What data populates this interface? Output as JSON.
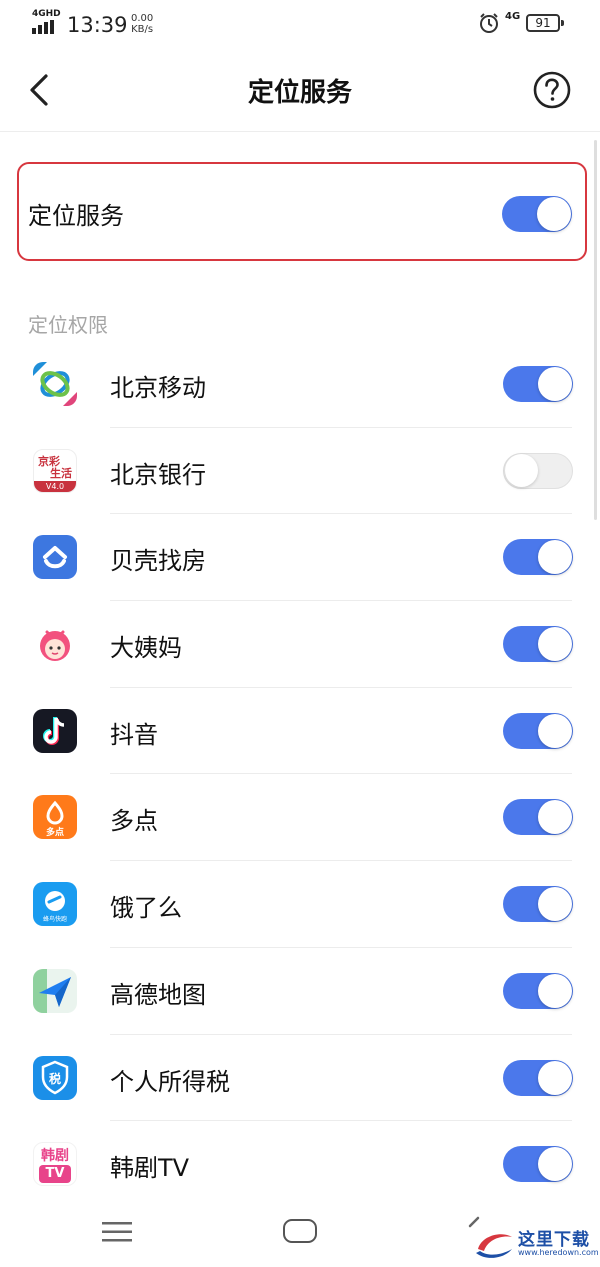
{
  "status_bar": {
    "network": "4GHD",
    "time": "13:39",
    "speed_value": "0.00",
    "speed_unit": "KB/s",
    "network_right": "4G",
    "battery": "91"
  },
  "header": {
    "title": "定位服务"
  },
  "master": {
    "label": "定位服务",
    "enabled": true
  },
  "section_title": "定位权限",
  "apps": [
    {
      "name": "北京移动",
      "enabled": true,
      "icon": "china-mobile-icon"
    },
    {
      "name": "北京银行",
      "enabled": false,
      "icon": "bank-of-beijing-icon"
    },
    {
      "name": "贝壳找房",
      "enabled": true,
      "icon": "beike-icon"
    },
    {
      "name": "大姨妈",
      "enabled": true,
      "icon": "dayima-icon"
    },
    {
      "name": "抖音",
      "enabled": true,
      "icon": "douyin-icon"
    },
    {
      "name": "多点",
      "enabled": true,
      "icon": "duodian-icon"
    },
    {
      "name": "饿了么",
      "enabled": true,
      "icon": "eleme-icon"
    },
    {
      "name": "高德地图",
      "enabled": true,
      "icon": "amap-icon"
    },
    {
      "name": "个人所得税",
      "enabled": true,
      "icon": "tax-icon"
    },
    {
      "name": "韩剧TV",
      "enabled": true,
      "icon": "hanju-tv-icon"
    }
  ],
  "icon_text": {
    "bank_line1": "京彩",
    "bank_line2": "生活",
    "bank_version": "V4.0",
    "duodian": "多点",
    "eleme": "蜂鸟快跑",
    "tax": "税",
    "hanju_line1": "韩剧",
    "hanju_line2": "TV"
  },
  "watermark": {
    "text": "这里下载",
    "url": "www.heredown.com"
  },
  "colors": {
    "toggle_on": "#4b78eb",
    "highlight_border": "#d7373f"
  }
}
